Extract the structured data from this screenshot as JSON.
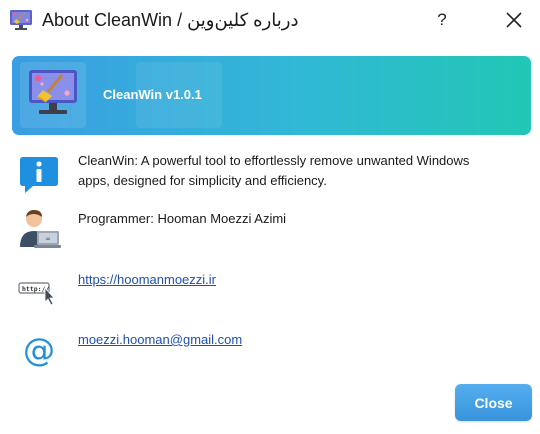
{
  "window": {
    "title": "About CleanWin / درباره کلین‌وین",
    "help_label": "?",
    "icons": {
      "app": "app-monitor-broom-icon",
      "close": "close-icon"
    }
  },
  "banner": {
    "title": "CleanWin v1.0.1",
    "icon": "monitor-broom-icon",
    "gradient": [
      "#3a9ee2",
      "#22c7b4"
    ]
  },
  "rows": {
    "description": {
      "icon": "info-icon",
      "text": "CleanWin: A powerful tool to effortlessly remove unwanted Windows apps, designed for simplicity and efficiency."
    },
    "programmer": {
      "icon": "programmer-icon",
      "text": "Programmer: Hooman Moezzi Azimi"
    },
    "website": {
      "icon": "web-link-icon",
      "text": "https://hoomanmoezzi.ir"
    },
    "email": {
      "icon": "at-sign-icon",
      "text": "moezzi.hooman@gmail.com"
    }
  },
  "footer": {
    "close_label": "Close",
    "close_color": "#3894dd"
  }
}
